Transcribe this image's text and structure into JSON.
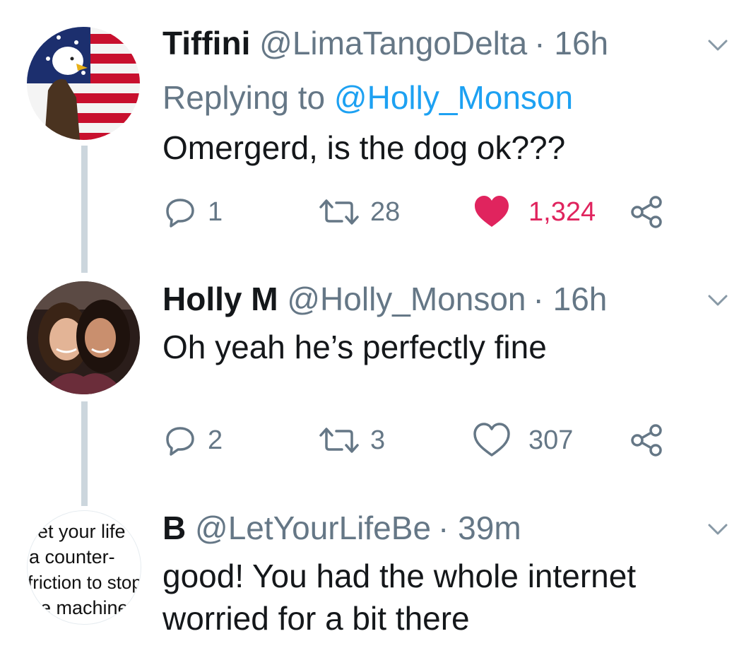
{
  "tweets": [
    {
      "name": "Tiffini",
      "handle": "@LimaTangoDelta",
      "separator": "·",
      "time": "16h",
      "reply_prefix": "Replying to",
      "reply_to": "@Holly_Monson",
      "text": "Omergerd, is the dog ok???",
      "replies": "1",
      "retweets": "28",
      "likes": "1,324",
      "liked": true
    },
    {
      "name": "Holly M",
      "handle": "@Holly_Monson",
      "separator": "·",
      "time": "16h",
      "text": "Oh yeah he’s perfectly fine",
      "replies": "2",
      "retweets": "3",
      "likes": "307",
      "liked": false
    },
    {
      "name": "B",
      "handle": "@LetYourLifeBe",
      "separator": "·",
      "time": "39m",
      "text": "good!  You had the whole internet worried for a bit there",
      "avatar_text": [
        "et your life",
        "a counter-",
        "friction to stop",
        "e machine"
      ]
    }
  ],
  "colors": {
    "like_red": "#e0245e",
    "link_blue": "#1da1f2",
    "secondary_gray": "#657786",
    "thread_line": "#ccd6dd"
  },
  "icons": [
    "reply-icon",
    "retweet-icon",
    "heart-icon",
    "share-icon",
    "chevron-down-icon"
  ]
}
